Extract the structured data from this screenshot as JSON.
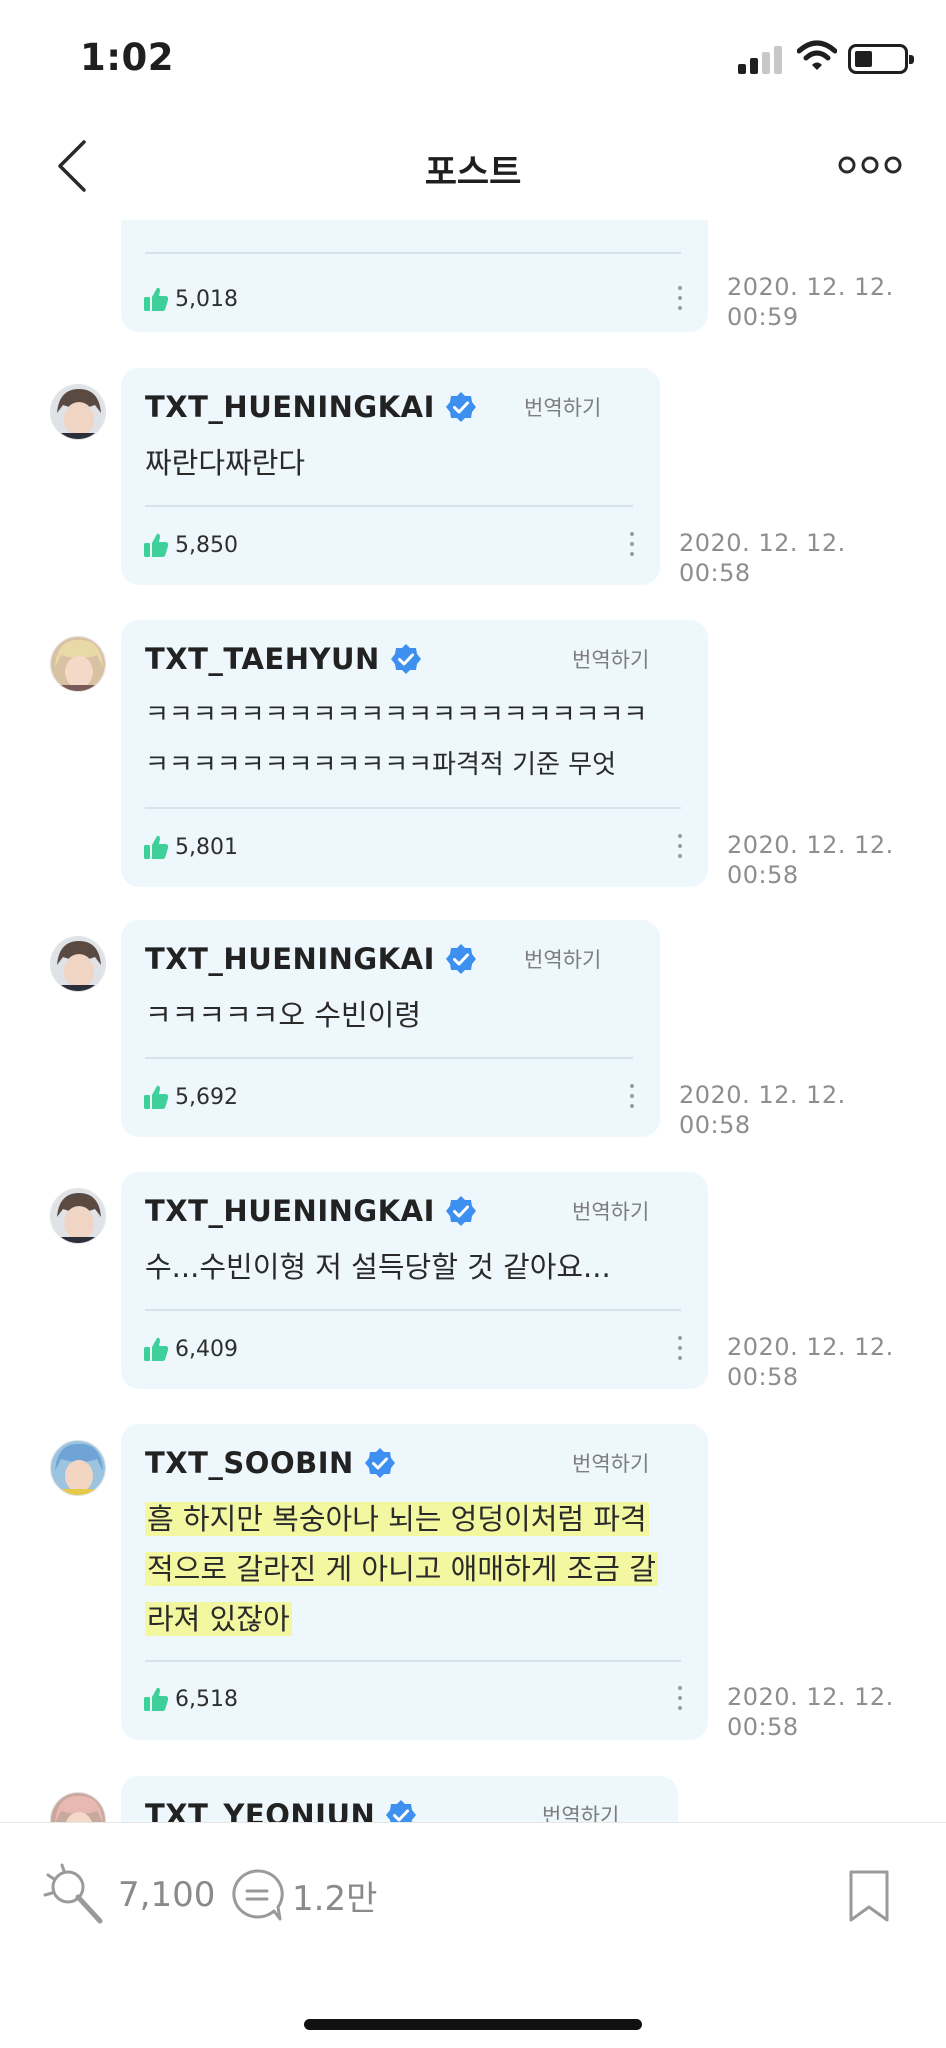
{
  "status_bar": {
    "time": "1:02",
    "signal_bars": 2,
    "battery_level_percent": 30
  },
  "nav": {
    "title": "포스트"
  },
  "posts": [
    {
      "partial": true,
      "likes": "5,018",
      "timestamp": "2020. 12. 12.\n00:59"
    },
    {
      "author": "TXT_HUENINGKAI",
      "translate_label": "번역하기",
      "lines": [
        "짜란다짜란다"
      ],
      "likes": "5,850",
      "timestamp": "2020. 12. 12.\n00:58"
    },
    {
      "author": "TXT_TAEHYUN",
      "translate_label": "번역하기",
      "lines": [
        "ㅋㅋㅋㅋㅋㅋㅋㅋㅋㅋㅋㅋㅋㅋㅋㅋㅋㅋㅋㅋㅋ",
        "ㅋㅋㅋㅋㅋㅋㅋㅋㅋㅋㅋㅋ파격적 기준 무엇"
      ],
      "likes": "5,801",
      "timestamp": "2020. 12. 12.\n00:58"
    },
    {
      "author": "TXT_HUENINGKAI",
      "translate_label": "번역하기",
      "lines": [
        "ㅋㅋㅋㅋㅋ오 수빈이령"
      ],
      "likes": "5,692",
      "timestamp": "2020. 12. 12.\n00:58"
    },
    {
      "author": "TXT_HUENINGKAI",
      "translate_label": "번역하기",
      "lines": [
        "수...수빈이형 저 설득당할 것 같아요..."
      ],
      "likes": "6,409",
      "timestamp": "2020. 12. 12.\n00:58"
    },
    {
      "author": "TXT_SOOBIN",
      "translate_label": "번역하기",
      "lines": [
        "흠 하지만 복숭아나 뇌는 엉덩이처럼 파격",
        "적으로 갈라진 게 아니고 애매하게 조금 갈",
        "라져 있잖아"
      ],
      "highlighted": true,
      "likes": "6,518",
      "timestamp": "2020. 12. 12.\n00:58"
    },
    {
      "author": "TXT_YEONJUN",
      "translate_label": "번역하기",
      "partial": true
    }
  ],
  "bottom_bar": {
    "likes": "7,100",
    "comments": "1.2만"
  },
  "colors": {
    "bubble": "#eef8fc",
    "like_green": "#3ecf9a",
    "verified_blue": "#3d8ff0",
    "highlight": "#f3f7a0"
  }
}
